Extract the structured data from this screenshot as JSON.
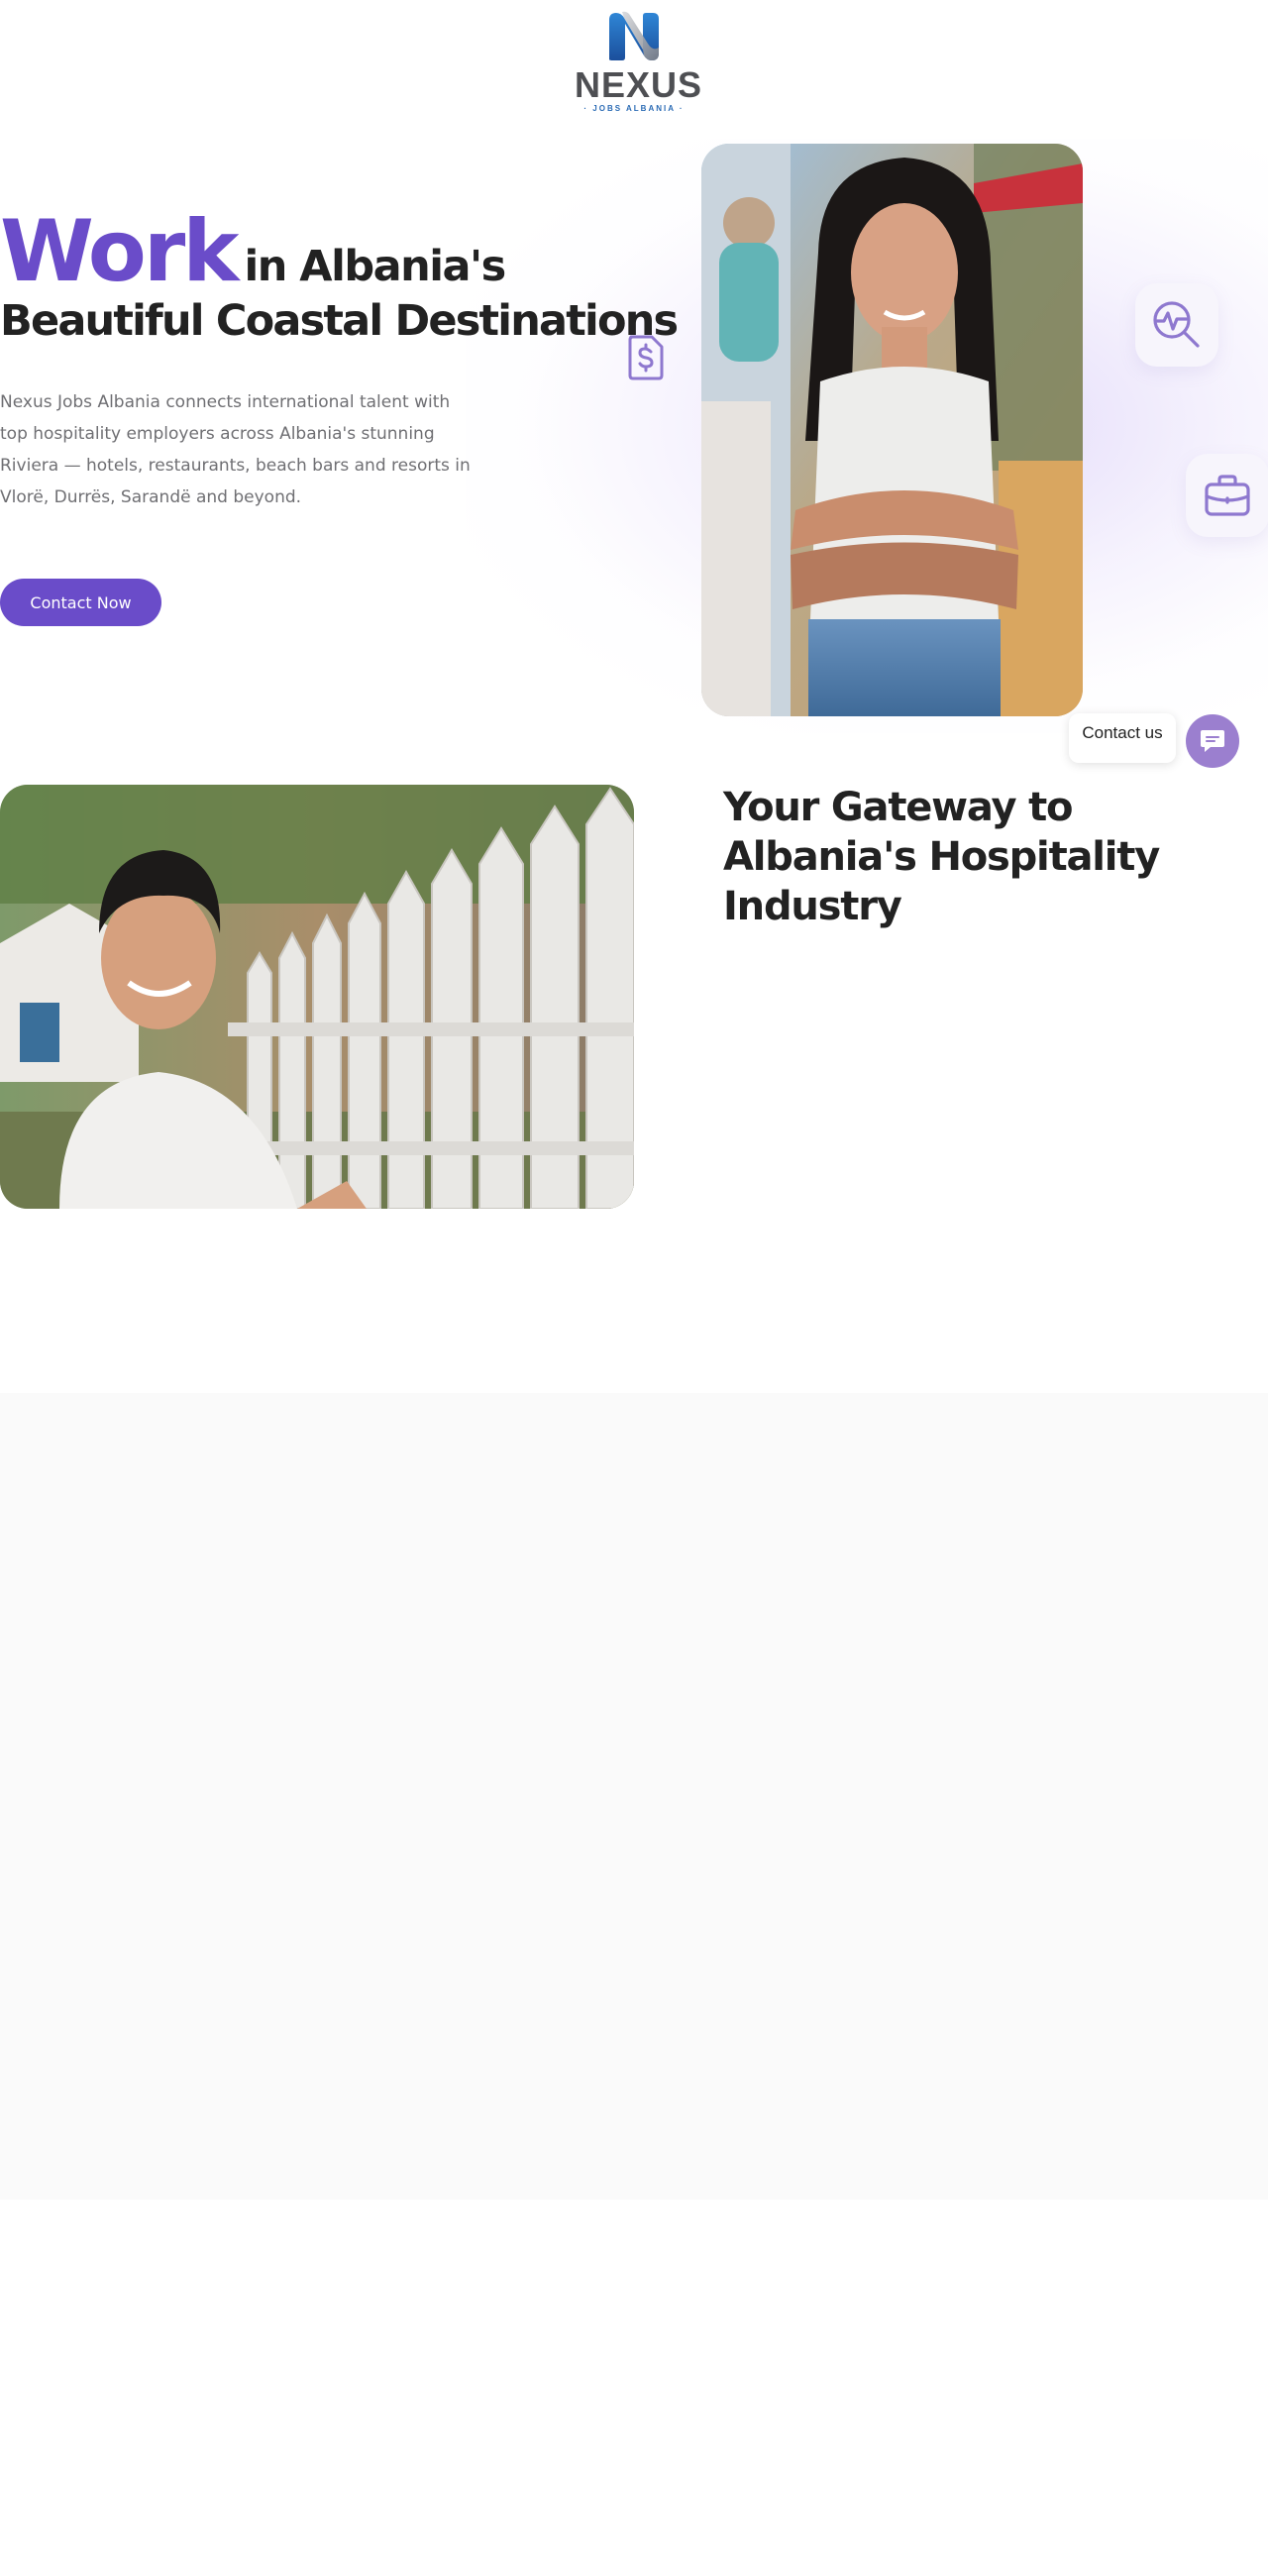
{
  "logo": {
    "name": "NEXUS",
    "tagline": "· JOBS ALBANIA ·"
  },
  "hero": {
    "title_highlight": "Work",
    "title_rest_line1": "in Albania's",
    "title_line2": "Beautiful Coastal Destinations",
    "description": "Nexus Jobs Albania connects international talent with top hospitality employers across Albania's stunning Riviera — hotels, restaurants, beach bars and resorts in Vlorë, Durrës, Sarandë and beyond.",
    "cta_label": "Contact Now"
  },
  "about": {
    "title": "Your Gateway to Albania's Hospitality Industry"
  },
  "chat_widget": {
    "tooltip": "Contact us"
  },
  "icons": [
    "logo-n-icon",
    "dollar-document-icon",
    "search-activity-icon",
    "briefcase-icon",
    "chat-icon"
  ],
  "colors": {
    "accent": "#6a4cc9",
    "heading": "#222222",
    "body_text": "#6f6f73",
    "chat_button": "#9b7fcf",
    "band": "#fafafa"
  }
}
